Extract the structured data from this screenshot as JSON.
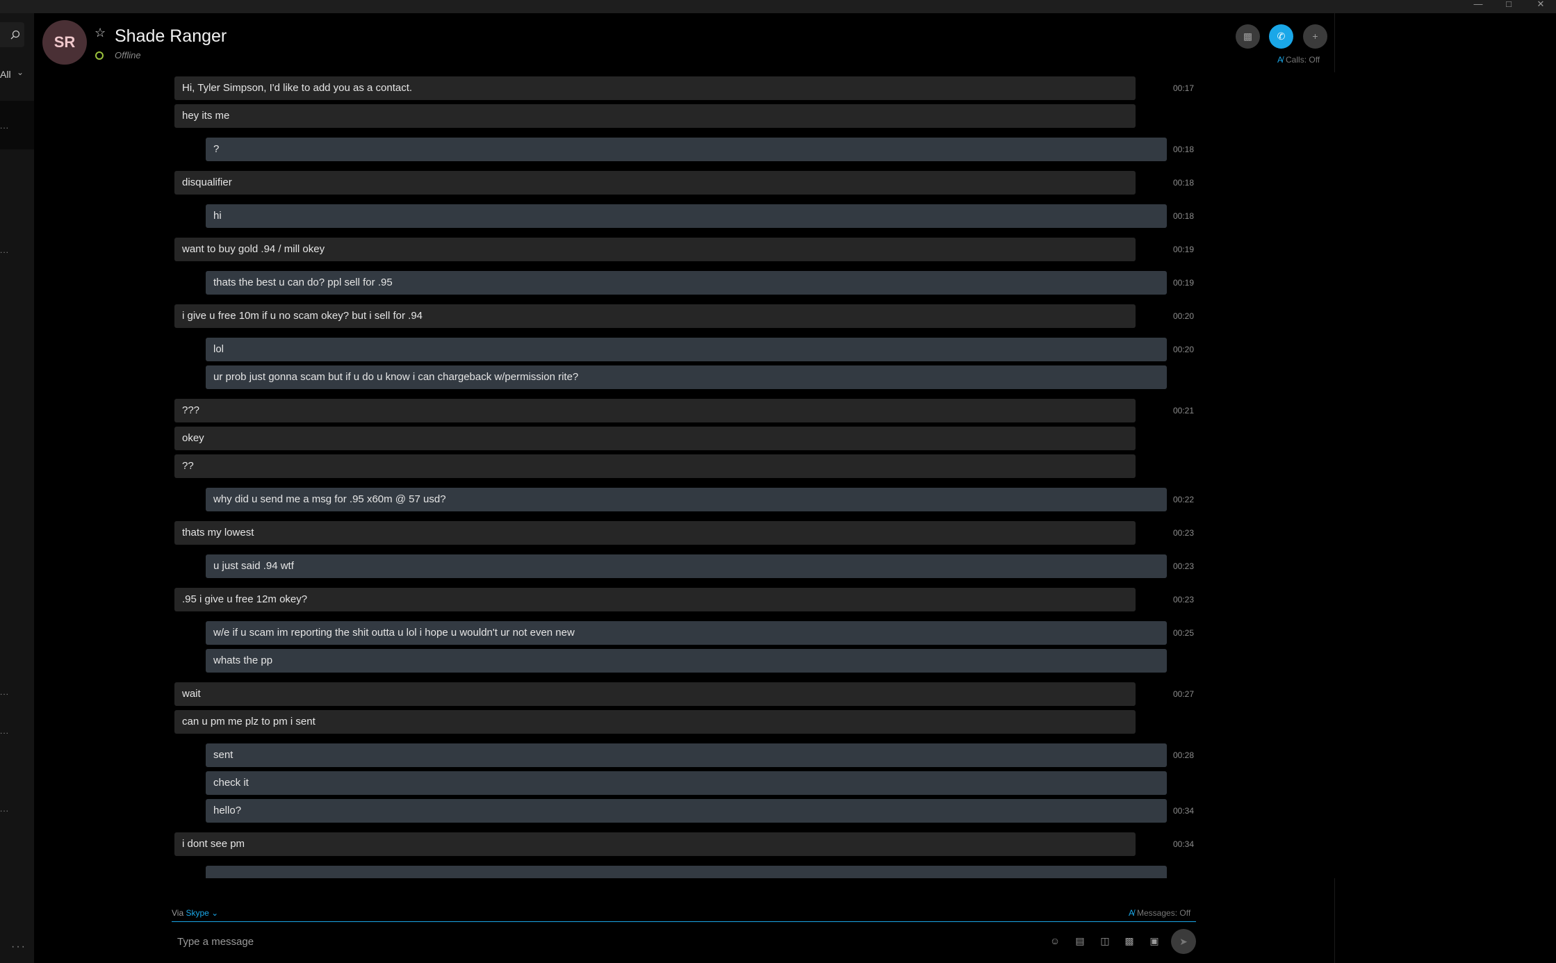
{
  "contact": {
    "initials": "SR",
    "name": "Shade Ranger",
    "status": "Offline"
  },
  "sidebar": {
    "filter": "All"
  },
  "header": {
    "calls_status": "Calls: Off"
  },
  "messages": [
    {
      "dir": "in",
      "text": "Hi, Tyler Simpson, I'd like to add you as a contact.",
      "time": "00:17"
    },
    {
      "dir": "in",
      "text": "hey its me",
      "time": ""
    },
    {
      "dir": "out",
      "text": "?",
      "time": "00:18"
    },
    {
      "dir": "in",
      "text": "disqualifier",
      "time": "00:18"
    },
    {
      "dir": "out",
      "text": "hi",
      "time": "00:18"
    },
    {
      "dir": "in",
      "text": "want to buy gold .94 / mill okey",
      "time": "00:19"
    },
    {
      "dir": "out",
      "text": "thats the best u can do? ppl sell for .95",
      "time": "00:19"
    },
    {
      "dir": "in",
      "text": "i give u free 10m if u no scam okey? but i sell for .94",
      "time": "00:20"
    },
    {
      "dir": "out",
      "text": "lol",
      "time": "00:20"
    },
    {
      "dir": "out",
      "text": "ur prob just gonna scam but if u do u know i can chargeback w/permission rite?",
      "time": ""
    },
    {
      "dir": "in",
      "text": "???",
      "time": "00:21"
    },
    {
      "dir": "in",
      "text": "okey",
      "time": ""
    },
    {
      "dir": "in",
      "text": "??",
      "time": ""
    },
    {
      "dir": "out",
      "text": "why did u send me a msg for .95 x60m @ 57 usd?",
      "time": "00:22"
    },
    {
      "dir": "in",
      "text": "thats my lowest",
      "time": "00:23"
    },
    {
      "dir": "out",
      "text": "u just said .94 wtf",
      "time": "00:23"
    },
    {
      "dir": "in",
      "text": ".95 i give u free 12m okey?",
      "time": "00:23"
    },
    {
      "dir": "out",
      "text": "w/e if u scam im reporting the shit outta u lol i hope u wouldn't ur not even new",
      "time": "00:25"
    },
    {
      "dir": "out",
      "text": "whats the pp",
      "time": ""
    },
    {
      "dir": "in",
      "text": "wait",
      "time": "00:27"
    },
    {
      "dir": "in",
      "text": "can u pm me plz to pm i sent",
      "time": ""
    },
    {
      "dir": "out",
      "text": "sent",
      "time": "00:28"
    },
    {
      "dir": "out",
      "text": "check it",
      "time": ""
    },
    {
      "dir": "out",
      "text": "hello?",
      "time": "00:34"
    },
    {
      "dir": "in",
      "text": "i dont see pm",
      "time": "00:34"
    },
    {
      "dir": "out",
      "text": "",
      "time": ""
    }
  ],
  "compose": {
    "via_label": "Via",
    "via_service": "Skype",
    "messages_status": "Messages: Off",
    "placeholder": "Type a message"
  },
  "icons": {
    "header": [
      "video-call-icon",
      "audio-call-icon",
      "add-people-icon"
    ],
    "compose": [
      "emoji-icon",
      "image-icon",
      "file-icon",
      "video-message-icon",
      "contact-card-icon",
      "send-icon"
    ]
  },
  "colors": {
    "accent": "#1aa7e8",
    "presence": "#9bc23c",
    "incoming_bubble": "#262626",
    "outgoing_bubble": "#333a42"
  }
}
